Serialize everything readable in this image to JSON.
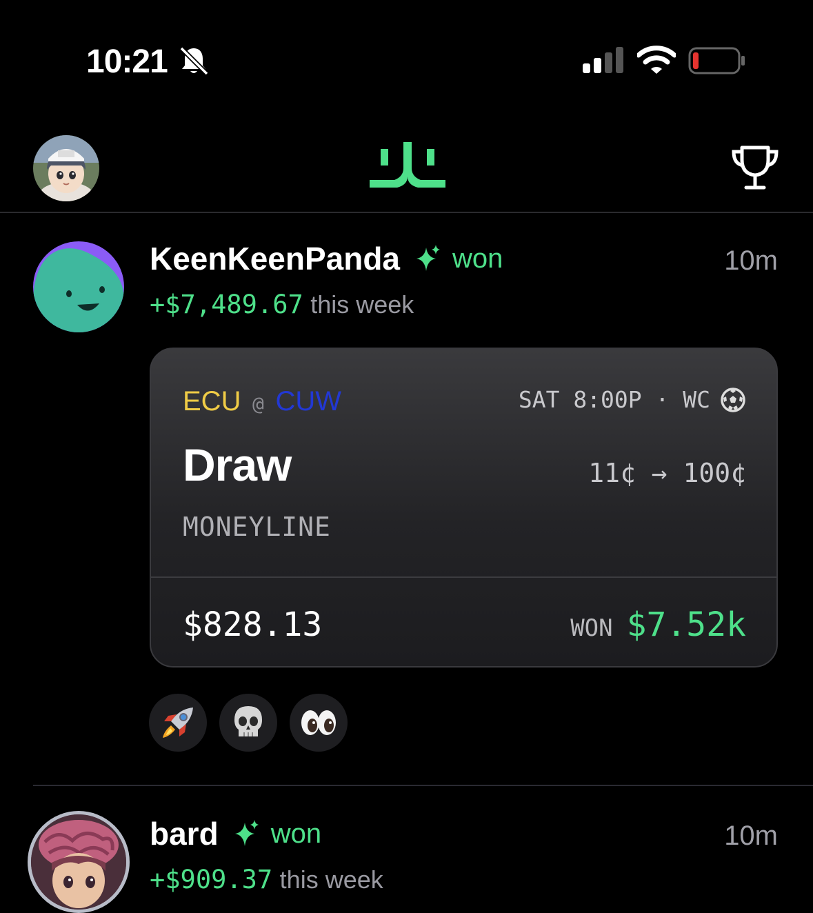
{
  "status_bar": {
    "time": "10:21",
    "icons": [
      "bell-slash-icon",
      "cellular-signal-icon",
      "wifi-icon",
      "battery-low-icon"
    ],
    "battery_color": "#e5342f"
  },
  "header": {
    "logo_icon": "app-logo-icon",
    "leaderboard_icon": "trophy-icon"
  },
  "theme": {
    "accent": "#4ee08a",
    "background": "#000000"
  },
  "feed": [
    {
      "username": "KeenKeenPanda",
      "action": "won",
      "time_ago": "10m",
      "pnl": "+$7,489.67",
      "pnl_suffix": "this week",
      "bet": {
        "away_team": "ECU",
        "at": "@",
        "home_team": "CUW",
        "away_color": "#f0cc46",
        "home_color": "#2238d4",
        "schedule": "SAT 8:00P · WC",
        "sport_icon": "soccer-ball-icon",
        "pick": "Draw",
        "price": "11¢ → 100¢",
        "market": "MONEYLINE",
        "stake": "$828.13",
        "result_label": "WON",
        "result_amount": "$7.52k"
      },
      "reactions": [
        "🚀",
        "💀",
        "👀"
      ]
    },
    {
      "username": "bard",
      "action": "won",
      "time_ago": "10m",
      "pnl": "+$909.37",
      "pnl_suffix": "this week"
    }
  ]
}
